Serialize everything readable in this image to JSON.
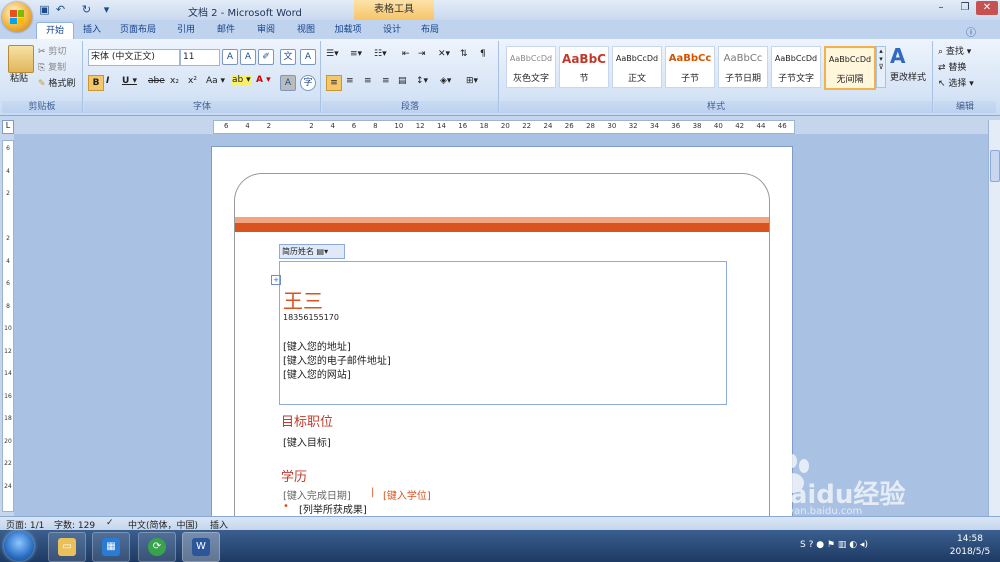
{
  "window": {
    "title": "文档 2 - Microsoft Word",
    "context_tab": "表格工具"
  },
  "tabs": [
    {
      "label": "开始"
    },
    {
      "label": "插入"
    },
    {
      "label": "页面布局"
    },
    {
      "label": "引用"
    },
    {
      "label": "邮件"
    },
    {
      "label": "审阅"
    },
    {
      "label": "视图"
    },
    {
      "label": "加载项"
    },
    {
      "label": "设计"
    },
    {
      "label": "布局"
    }
  ],
  "clipboard": {
    "paste": "粘贴",
    "cut": "剪切",
    "copy": "复制",
    "format_painter": "格式刷",
    "group": "剪贴板"
  },
  "font": {
    "name": "宋体 (中文正文)",
    "size": "11",
    "group": "字体"
  },
  "paragraph": {
    "group": "段落"
  },
  "styles": {
    "group": "样式",
    "change_styles": "更改样式",
    "items": [
      {
        "sample": "AaBbCcDd",
        "name": "灰色文字"
      },
      {
        "sample": "AaBbC",
        "name": "节"
      },
      {
        "sample": "AaBbCcDd",
        "name": "正文"
      },
      {
        "sample": "AaBbCc",
        "name": "子节"
      },
      {
        "sample": "AaBbCc",
        "name": "子节日期"
      },
      {
        "sample": "AaBbCcDd",
        "name": "子节文字"
      },
      {
        "sample": "AaBbCcDd",
        "name": "无间隔"
      }
    ]
  },
  "editing": {
    "group": "编辑",
    "find": "查找",
    "replace": "替换",
    "select": "选择"
  },
  "ruler": {
    "ticks": [
      "6",
      "4",
      "2",
      "",
      "2",
      "4",
      "6",
      "8",
      "10",
      "12",
      "14",
      "16",
      "18",
      "20",
      "22",
      "24",
      "26",
      "28",
      "30",
      "32",
      "34",
      "36",
      "38",
      "40",
      "42",
      "44",
      "46"
    ]
  },
  "vruler": {
    "ticks": [
      "6",
      "4",
      "2",
      "",
      "2",
      "4",
      "6",
      "8",
      "10",
      "12",
      "14",
      "16",
      "18",
      "20",
      "22",
      "24"
    ]
  },
  "document": {
    "control_label": "简历姓名",
    "name": "王三",
    "phone": "18356155170",
    "address": "[键入您的地址]",
    "email": "[键入您的电子邮件地址]",
    "website": "[键入您的网站]",
    "section1": "目标职位",
    "section1_body": "[键入目标]",
    "section2": "学历",
    "date_line": "[键入完成日期]",
    "separator": "|",
    "degree": "[键入学位]",
    "bullet": "[列举所获成果]"
  },
  "status": {
    "page": "页面: 1/1",
    "words": "字数: 129",
    "language": "中文(简体，中国)",
    "mode": "插入"
  },
  "tray": {
    "time": "14:58",
    "date": "2018/5/5"
  },
  "watermark": {
    "brand": "Baidu经验",
    "url": "jingyan.baidu.com"
  }
}
